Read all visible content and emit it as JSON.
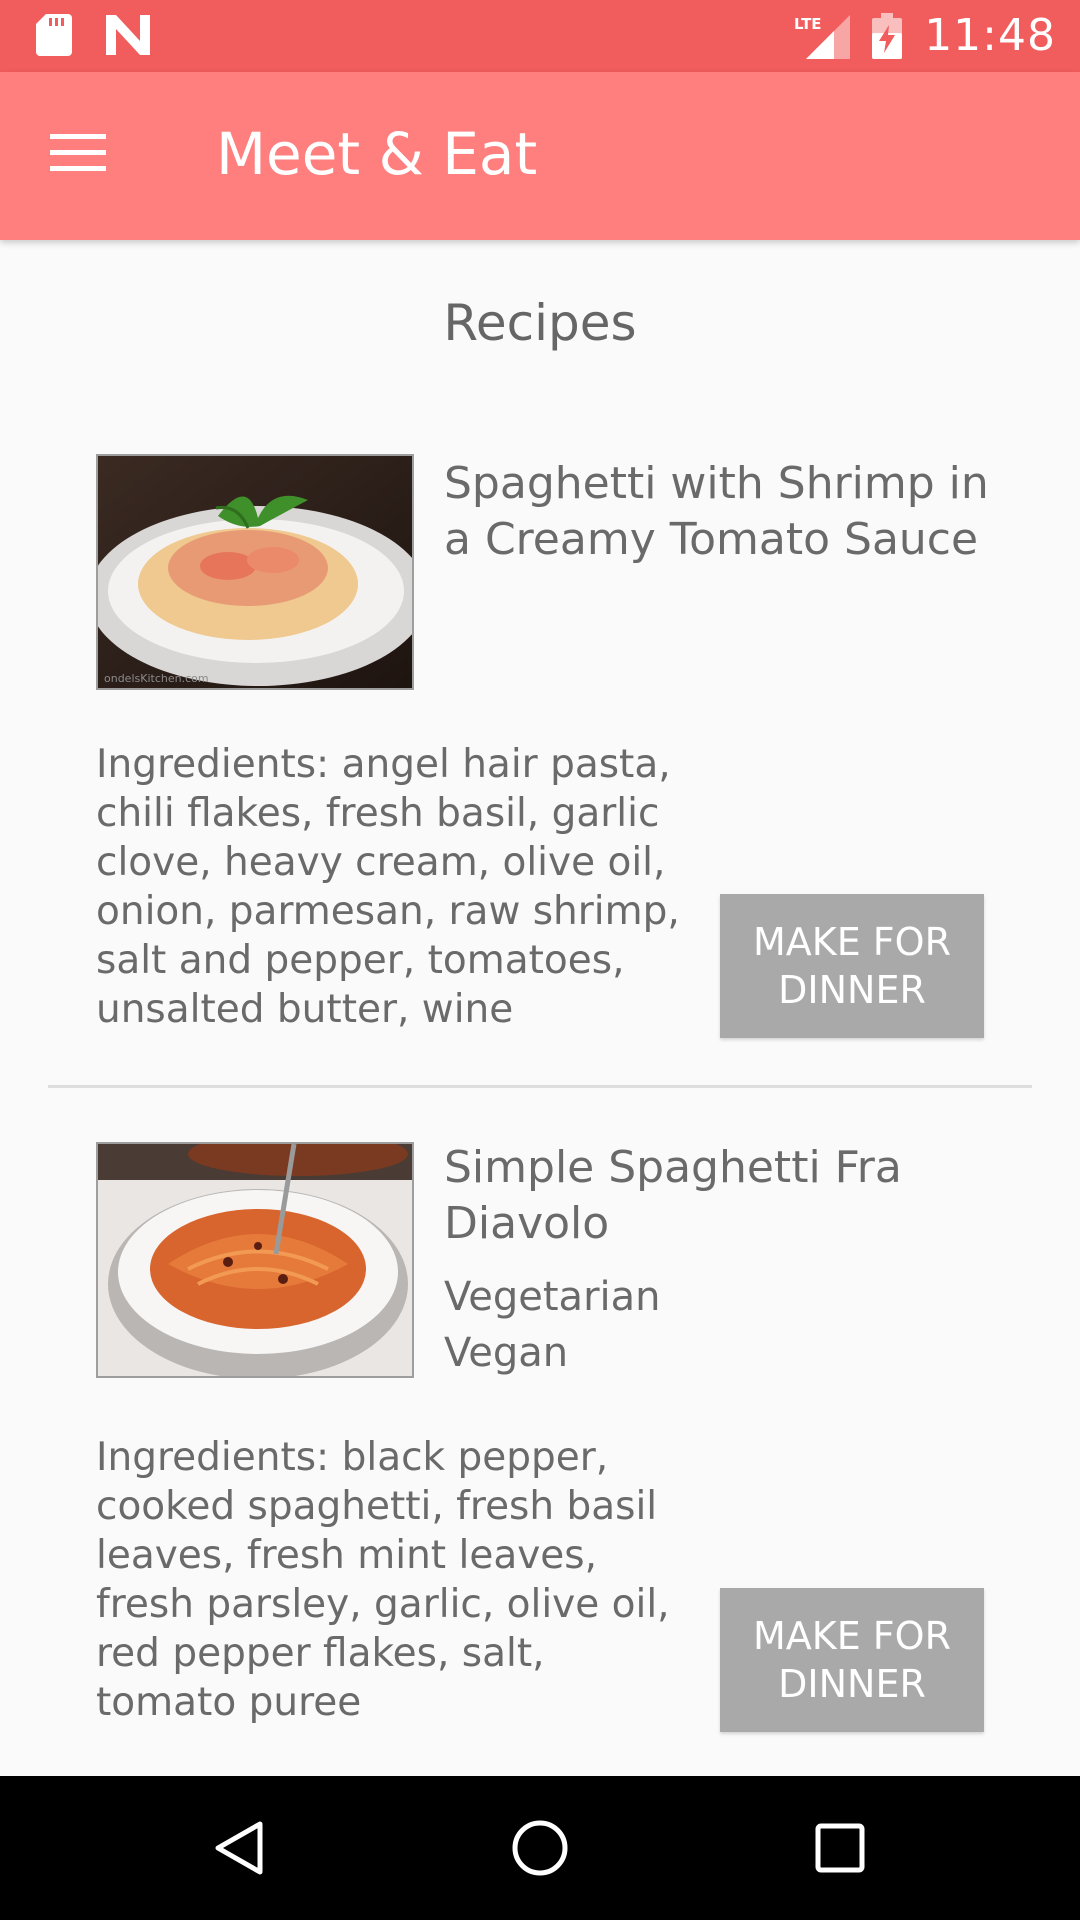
{
  "status_bar": {
    "time": "11:48",
    "network": "LTE",
    "icons": [
      "sd-card-icon",
      "n-logo-icon",
      "lte-signal-icon",
      "battery-charging-icon"
    ]
  },
  "app_bar": {
    "title": "Meet & Eat",
    "menu_icon": "hamburger-menu-icon"
  },
  "page": {
    "title": "Recipes"
  },
  "recipes": [
    {
      "name": "Spaghetti with Shrimp in a Creamy Tomato Sauce",
      "tags": [],
      "ingredients": "Ingredients: angel hair pasta, chili flakes, fresh basil, garlic clove, heavy cream, olive oil, onion, parmesan, raw shrimp, salt and pepper, tomatoes, unsalted butter, wine",
      "button_label": "MAKE FOR DINNER",
      "image_watermark": "ondelsKitchen.com"
    },
    {
      "name": "Simple Spaghetti Fra Diavolo",
      "tags": [
        "Vegetarian",
        "Vegan"
      ],
      "ingredients": "Ingredients: black pepper, cooked spaghetti, fresh basil leaves, fresh mint leaves, fresh parsley, garlic, olive oil, red pepper flakes, salt, tomato puree",
      "button_label": "MAKE FOR DINNER"
    }
  ],
  "nav_bar": {
    "buttons": [
      "back-icon",
      "home-icon",
      "recents-icon"
    ]
  },
  "colors": {
    "status_bar": "#f15c5c",
    "app_bar": "#ff7f7f",
    "button": "#a9a9a9",
    "text": "#6a6a6a"
  }
}
